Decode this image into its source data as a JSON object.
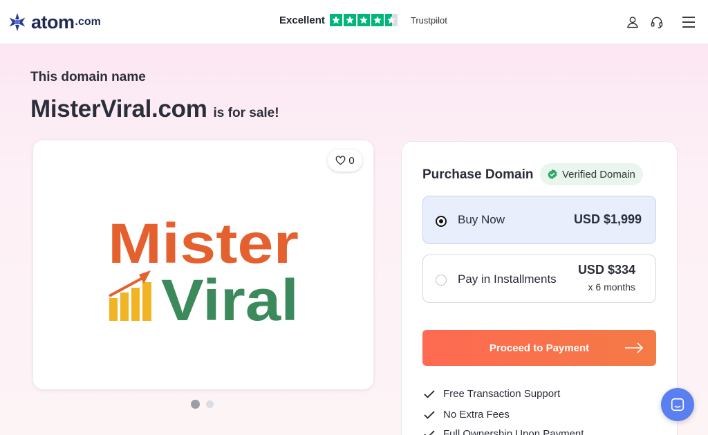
{
  "header": {
    "logo_text": "atom",
    "logo_tld": ".com",
    "rating_label": "Excellent",
    "rating_stars": 4.5,
    "rating_provider": "Trustpilot",
    "icons": [
      "user-icon",
      "headset-icon",
      "menu-icon"
    ]
  },
  "hero": {
    "subtitle": "This domain name",
    "domain": "MisterViral.com",
    "for_sale": "is for sale!"
  },
  "gallery": {
    "likes": "0",
    "logo_line1": "Mister",
    "logo_line2": "Viral",
    "slides": 2,
    "active_slide": 1
  },
  "purchase": {
    "title": "Purchase Domain",
    "verified_label": "Verified Domain",
    "options": [
      {
        "label": "Buy Now",
        "price": "USD $1,999",
        "selected": true
      },
      {
        "label": "Pay in Installments",
        "price": "USD $334",
        "sub": "x 6 months",
        "selected": false
      }
    ],
    "cta_label": "Proceed to Payment",
    "features": [
      "Free Transaction Support",
      "No Extra Fees",
      "Full Ownership Upon Payment"
    ]
  },
  "colors": {
    "brand": "#1f2b55",
    "trustpilot": "#00b67a",
    "cta": "#fe6a52",
    "selected_bg": "#e9eefc",
    "chat": "#5a7ff0",
    "mister_orange": "#e4612f",
    "viral_green": "#3c8a5c"
  }
}
